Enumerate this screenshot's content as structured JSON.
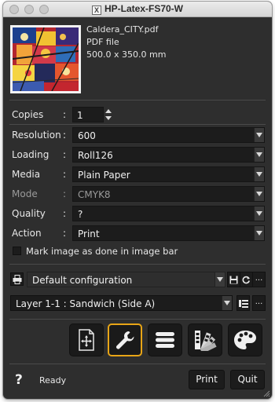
{
  "window": {
    "title": "HP-Latex-FS70-W"
  },
  "file": {
    "name": "Caldera_CITY.pdf",
    "type": "PDF file",
    "size": "500.0 x 350.0 mm"
  },
  "form": {
    "copies": {
      "label": "Copies",
      "value": "1"
    },
    "resolution": {
      "label": "Resolution",
      "value": "600"
    },
    "loading": {
      "label": "Loading",
      "value": "Roll126"
    },
    "media": {
      "label": "Media",
      "value": "Plain Paper"
    },
    "mode": {
      "label": "Mode",
      "value": "CMYK8",
      "disabled": true
    },
    "quality": {
      "label": "Quality",
      "value": "?"
    },
    "action": {
      "label": "Action",
      "value": "Print"
    },
    "colon": ":"
  },
  "mark_done": {
    "label": "Mark image as done in image bar",
    "checked": false
  },
  "configuration": {
    "value": "Default configuration",
    "more_label": "..."
  },
  "layer": {
    "value": "Layer 1-1 : Sandwich (Side A)",
    "more_label": "..."
  },
  "toolbar": {
    "active_tool": "settings",
    "tools": [
      "placement",
      "settings",
      "list",
      "swatches",
      "color-palette"
    ]
  },
  "footer": {
    "help": "?",
    "status": "Ready",
    "print_label": "Print",
    "quit_label": "Quit"
  },
  "colors": {
    "accent": "#e8a516",
    "panel": "#2e2e2e",
    "field": "#1c1c1c"
  }
}
